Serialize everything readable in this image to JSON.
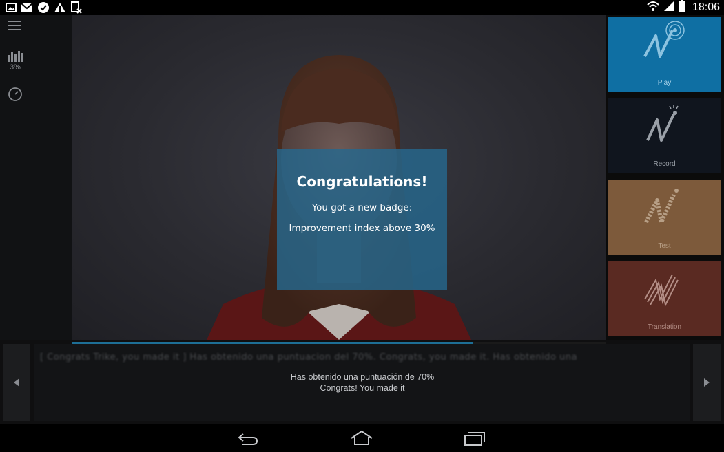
{
  "status_bar": {
    "time": "18:06",
    "icons_left": [
      "picture-icon",
      "gmail-icon",
      "check-circle-icon",
      "warning-icon",
      "sim-off-icon"
    ],
    "icons_right": [
      "wifi-icon",
      "signal-icon",
      "battery-icon"
    ]
  },
  "left_rail": {
    "menu_icon": "hamburger-menu-icon",
    "stats_icon": "bar-chart-icon",
    "stats_value": "3%",
    "speed_icon": "speedometer-icon"
  },
  "modal": {
    "title": "Congratulations!",
    "line1": "You got a new badge:",
    "line2": "Improvement index above 30%",
    "background": "#26688e"
  },
  "tiles": [
    {
      "label": "Play",
      "color": "#0f6fa3",
      "text_color": "#a9d3ea"
    },
    {
      "label": "Record",
      "color": "#10151e",
      "text_color": "#9aa0a8"
    },
    {
      "label": "Test",
      "color": "#7d5a3b",
      "text_color": "#b79f86"
    },
    {
      "label": "Translation",
      "color": "#5a2a22",
      "text_color": "#b48e86"
    }
  ],
  "progress": {
    "fraction": 0.75,
    "color": "#1d6e95"
  },
  "captions": {
    "scrolling_text": "[ Congrats Trike, you made it ] Has obtenido una puntuacion del 70%. Congrats, you made it. Has obtenido una",
    "line1": "Has obtenido una puntuación de 70%",
    "line2": "Congrats! You made it",
    "prev_icon": "left-arrow-icon",
    "next_icon": "right-arrow-icon"
  },
  "system_nav": {
    "back_icon": "back-icon",
    "home_icon": "home-icon",
    "recents_icon": "recents-icon"
  }
}
